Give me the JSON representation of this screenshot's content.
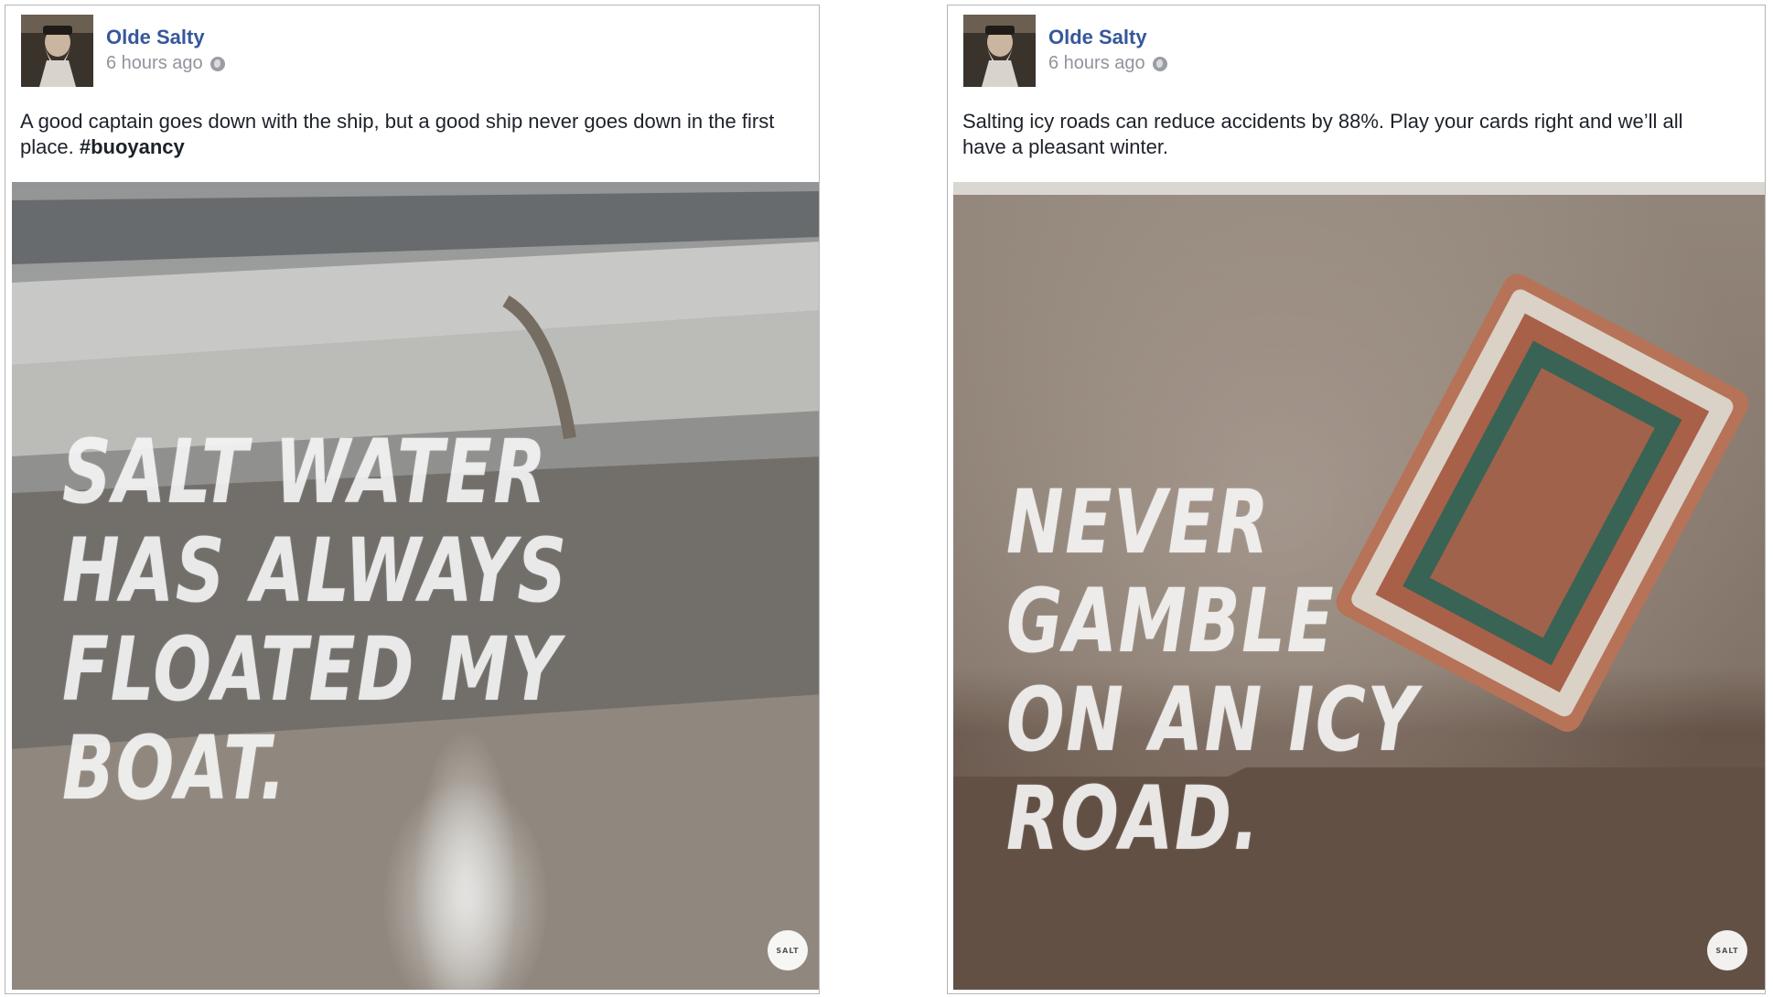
{
  "posts": [
    {
      "author": "Olde Salty",
      "timestamp": "6 hours ago",
      "caption_text": "A good captain goes down with the ship, but a good ship never goes down in the first place.",
      "hashtag": "#buoyancy",
      "headline_lines": [
        "SALT WATER",
        "HAS ALWAYS",
        "FLOATED MY BOAT."
      ],
      "logo_text": "SALT",
      "privacy_icon": "globe-icon"
    },
    {
      "author": "Olde Salty",
      "timestamp": "6 hours ago",
      "caption_text": "Salting icy roads can reduce accidents by 88%. Play your cards right and we’ll all have a pleasant winter.",
      "hashtag": "",
      "headline_lines": [
        "NEVER GAMBLE",
        "ON AN ICY ROAD."
      ],
      "logo_text": "SALT",
      "privacy_icon": "globe-icon"
    }
  ],
  "colors": {
    "author_link": "#365899",
    "timestamp": "#90949c",
    "border": "#b5b5b5"
  }
}
